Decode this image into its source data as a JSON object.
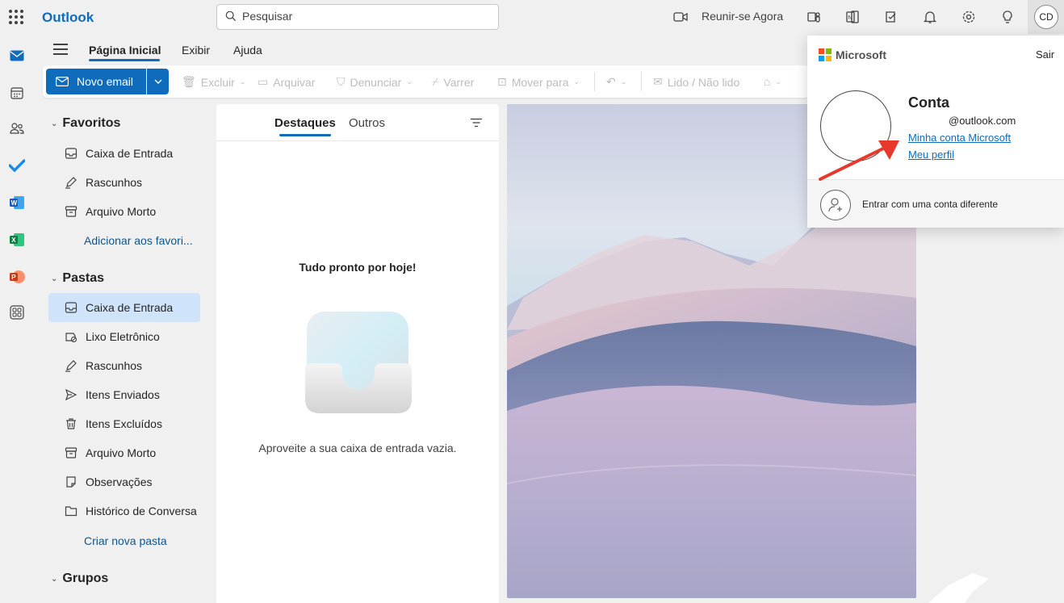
{
  "app": {
    "brand": "Outlook"
  },
  "search": {
    "placeholder": "Pesquisar"
  },
  "topbar": {
    "meet_now": "Reunir-se Agora",
    "avatar_initials": "CD"
  },
  "ribbon": {
    "tabs": [
      "Página Inicial",
      "Exibir",
      "Ajuda"
    ],
    "active_tab": "Página Inicial"
  },
  "toolbar": {
    "new_mail": "Novo email",
    "delete": "Excluir",
    "archive": "Arquivar",
    "report": "Denunciar",
    "sweep": "Varrer",
    "move_to": "Mover para",
    "read_unread": "Lido / Não lido"
  },
  "folders": {
    "favorites_title": "Favoritos",
    "favorites": [
      {
        "label": "Caixa de Entrada",
        "icon": "inbox-icon"
      },
      {
        "label": "Rascunhos",
        "icon": "pencil-icon"
      },
      {
        "label": "Arquivo Morto",
        "icon": "archive-icon"
      }
    ],
    "add_favorite": "Adicionar aos favori...",
    "folders_title": "Pastas",
    "items": [
      {
        "label": "Caixa de Entrada",
        "icon": "inbox-icon",
        "selected": true
      },
      {
        "label": "Lixo Eletrônico",
        "icon": "junk-icon"
      },
      {
        "label": "Rascunhos",
        "icon": "pencil-icon"
      },
      {
        "label": "Itens Enviados",
        "icon": "send-icon"
      },
      {
        "label": "Itens Excluídos",
        "icon": "trash-icon"
      },
      {
        "label": "Arquivo Morto",
        "icon": "archive-icon"
      },
      {
        "label": "Observações",
        "icon": "note-icon"
      },
      {
        "label": "Histórico de Conversa",
        "icon": "folder-icon"
      }
    ],
    "create_folder": "Criar nova pasta",
    "groups_title": "Grupos"
  },
  "message_list": {
    "tabs": [
      "Destaques",
      "Outros"
    ],
    "empty_title": "Tudo pronto por hoje!",
    "empty_subtitle": "Aproveite a sua caixa de entrada vazia."
  },
  "account": {
    "provider": "Microsoft",
    "sign_out": "Sair",
    "name": "Conta",
    "email": "@outlook.com",
    "my_account_link": "Minha conta Microsoft",
    "my_profile_link": "Meu perfil",
    "other_account": "Entrar com uma conta diferente"
  },
  "colors": {
    "accent": "#0f6cbd",
    "selected": "#cfe4fa",
    "annotation_arrow": "#e8382c"
  }
}
